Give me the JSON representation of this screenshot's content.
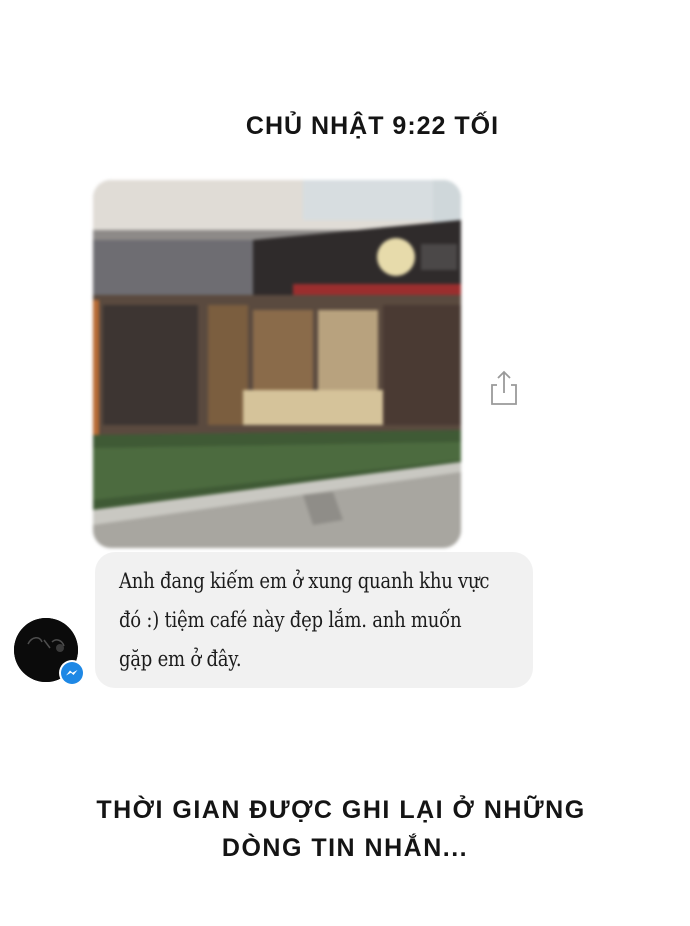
{
  "header": {
    "timestamp": "CHỦ NHẬT 9:22 TỐI"
  },
  "message": {
    "photo_icon": "blurred-cafe-photo",
    "share_icon": "share-icon",
    "text_line_1": "Anh đang kiếm em ở xung quanh khu vực",
    "text_line_2": "đó :) tiệm café này đẹp lắm. anh muốn",
    "text_line_3": "gặp em ở đây.",
    "avatar_icon": "avatar",
    "badge_icon": "messenger-icon"
  },
  "caption": {
    "line_1": "THỜI GIAN ĐƯỢC GHI LẠI Ở NHỮNG",
    "line_2": "DÒNG TIN NHẮN..."
  },
  "colors": {
    "bubble": "#f1f1f1",
    "messenger": "#1e88e5",
    "text": "#141414"
  }
}
